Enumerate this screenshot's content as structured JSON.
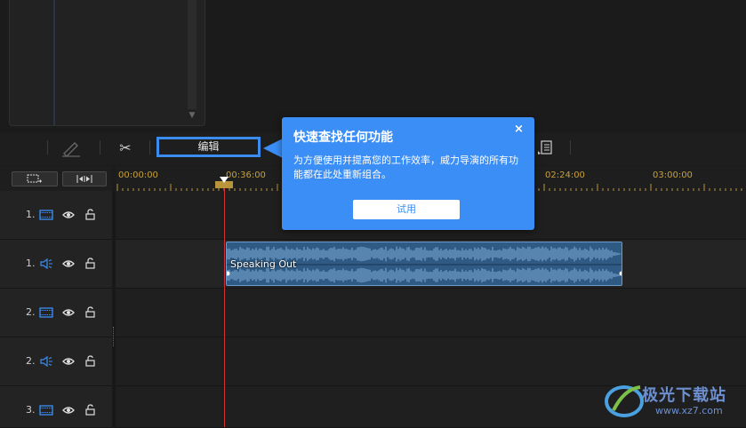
{
  "toolbar": {
    "edit_label": "编辑"
  },
  "timeline": {
    "time_labels": [
      "00:00:00",
      "00:36:00",
      "02:24:00",
      "03:00:00"
    ],
    "playhead_time": "00:36:00"
  },
  "tracks": [
    {
      "number": "1.",
      "type": "video"
    },
    {
      "number": "1.",
      "type": "audio"
    },
    {
      "number": "2.",
      "type": "video"
    },
    {
      "number": "2.",
      "type": "audio"
    },
    {
      "number": "3.",
      "type": "video"
    }
  ],
  "clip": {
    "label": "Speaking Out"
  },
  "popup": {
    "title": "快速查找任何功能",
    "close": "×",
    "body": "为方便使用并提高您的工作效率，威力导演的所有功能都在此处重新组合。",
    "button": "试用"
  },
  "watermark": {
    "title": "极光下载站",
    "url": "www.xz7.com"
  },
  "colors": {
    "accent": "#3a8ef6",
    "playhead": "#d03030",
    "time_label": "#c8a03a",
    "clip": "#2f5a84"
  }
}
